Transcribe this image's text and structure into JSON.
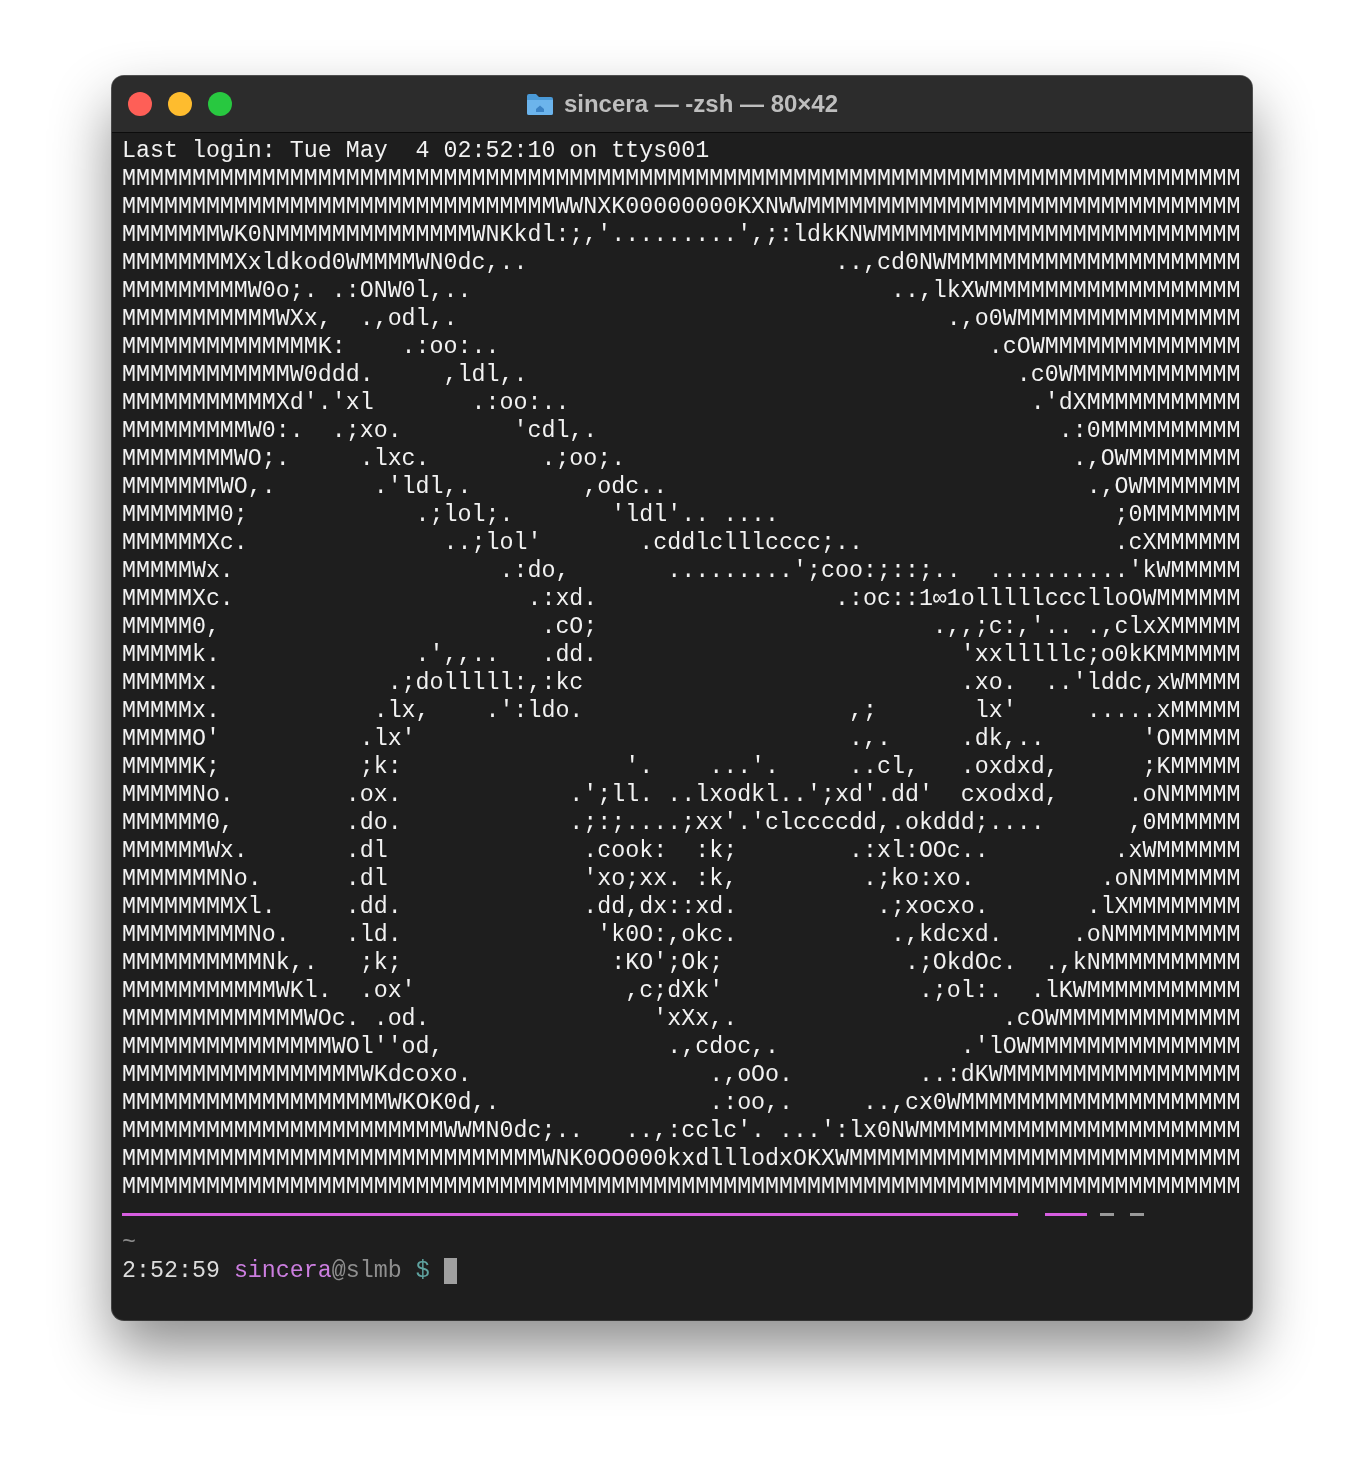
{
  "window": {
    "title": "sincera — -zsh — 80×42"
  },
  "terminal": {
    "lines": [
      "Last login: Tue May  4 02:52:10 on ttys001",
      "MMMMMMMMMMMMMMMMMMMMMMMMMMMMMMMMMMMMMMMMMMMMMMMMMMMMMMMMMMMMMMMMMMMMMMMMMMMMMMMM",
      "MMMMMMMMMMMMMMMMMMMMMMMMMMMMMMMWWNXK00000000KXNWWMMMMMMMMMMMMMMMMMMMMMMMMMMMMMMM",
      "MMMMMMMWK0NMMMMMMMMMMMMMMWNKkdl:;,'.........',;:ldkKNWMMMMMMMMMMMMMMMMMMMMMMMMMM",
      "MMMMMMMMXxldkod0WMMMMWN0dc,..                      ..,cd0NWMMMMMMMMMMMMMMMMMMMMM",
      "MMMMMMMMMW0o;. .:ONW0l,..                              ..,lkXWMMMMMMMMMMMMMMMMMM",
      "MMMMMMMMMMMWXx,  .,odl,.                                   .,o0WMMMMMMMMMMMMMMMM",
      "MMMMMMMMMMMMMMK:    .:oo:..                                   .cOWMMMMMMMMMMMMMM",
      "MMMMMMMMMMMMW0ddd.     ,ldl,.                                   .c0WMMMMMMMMMMMM",
      "MMMMMMMMMMMXd'.'xl       .:oo:..                                 .'dXMMMMMMMMMMM",
      "MMMMMMMMMW0:.  .;xo.        'cdl,.                                 .:0MMMMMMMMMM",
      "MMMMMMMMWO;.     .lxc.        .;oo;.                                .,OWMMMMMMMM",
      "MMMMMMMWO,.       .'ldl,.        ,odc..                              .,OWMMMMMMM",
      "MMMMMMM0;            .;lol;.       'ldl'.. ....                        ;0MMMMMMM",
      "MMMMMMXc.              ..;lol'       .cddlclllcccc;..                  .cXMMMMMM",
      "MMMMMWx.                   .:do,       .........';coo:;::;..  ..........'kWMMMMM",
      "MMMMMXc.                     .:xd.                 .:oc::1∞1olllllccclloOWMMMMMM",
      "MMMMM0,                       .cO;                        .,,;c:,'.. .,clxXMMMMM",
      "MMMMMk.              .',,..   .dd.                          'xxlllllc;o0kKMMMMMM",
      "MMMMMx.            .;dolllll:,:kc                           .xo.  ..'lddc,xWMMMM",
      "MMMMMx.           .lx,    .':ldo.                   ,;       lx'     .....xMMMMM",
      "MMMMMO'          .lx'                               .,.     .dk,..       'OMMMMM",
      "MMMMMK;          ;k:                '.    ...'.     ..cl,   .oxdxd,      ;KMMMMM",
      "MMMMMNo.        .ox.            .';ll. ..lxodkl..';xd'.dd'  cxodxd,     .oNMMMMM",
      "MMMMMM0,        .do.            .;:;....;xx'.'clccccdd,.okddd;....      ,0MMMMMM",
      "MMMMMMWx.       .dl              .cook:  :k;        .:xl:OOc..         .xWMMMMMM",
      "MMMMMMMNo.      .dl              'xo;xx. :k,         .;ko:xo.         .oNMMMMMMM",
      "MMMMMMMMXl.     .dd.             .dd,dx::xd.          .;xocxo.       .lXMMMMMMMM",
      "MMMMMMMMMNo.    .ld.              'k0O:,okc.           .,kdcxd.     .oNMMMMMMMMM",
      "MMMMMMMMMMNk,.   ;k;               :KO';Ok;             .;OkdOc.  .,kNMMMMMMMMMM",
      "MMMMMMMMMMMWKl.  .ox'               ,c;dXk'              .;ol:.  .lKWMMMMMMMMMMM",
      "MMMMMMMMMMMMMWOc. .od.                'xXx,.                   .cOWMMMMMMMMMMMMM",
      "MMMMMMMMMMMMMMMWOl''od,                .,cdoc,.             .'lOWMMMMMMMMMMMMMMM",
      "MMMMMMMMMMMMMMMMMWKdcoxo.                 .,oOo.         ..:dKWMMMMMMMMMMMMMMMMM",
      "MMMMMMMMMMMMMMMMMMMWKOK0d,.               .:oo,.     ..,cx0WMMMMMMMMMMMMMMMMMMMM",
      "MMMMMMMMMMMMMMMMMMMMMMMWWMN0dc;..   ..,:cclc'. ...':lx0NWMMMMMMMMMMMMMMMMMMMMMMM",
      "MMMMMMMMMMMMMMMMMMMMMMMMMMMMMMWNK0OO000kxdlllodxOKXWMMMMMMMMMMMMMMMMMMMMMMMMMMMM",
      "MMMMMMMMMMMMMMMMMMMMMMMMMMMMMMMMMMMMMMMMMMMMMMMMMMMMMMMMMMMMMMMMMMMMMMMMMMMMMMMM"
    ]
  },
  "prompt": {
    "directory": "~",
    "time": "2:52:59",
    "user": "sincera",
    "host": "@slmb",
    "symbol": "$"
  }
}
